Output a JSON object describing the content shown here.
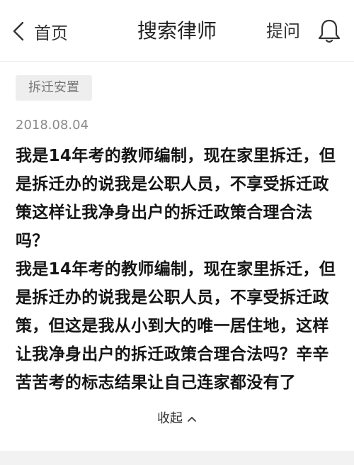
{
  "header": {
    "back_label": "首页",
    "title": "搜索律师",
    "ask_label": "提问"
  },
  "icons": {
    "back": "chevron-left-icon",
    "notifications": "bell-icon",
    "collapse": "chevron-up-icon"
  },
  "question": {
    "tag": "拆迁安置",
    "date": "2018.08.04",
    "title": "我是14年考的教师编制，现在家里拆迁，但是拆迁办的说我是公职人员，不享受拆迁政策这样让我净身出户的拆迁政策合理合法吗？",
    "body": "我是14年考的教师编制，现在家里拆迁，但是拆迁办的说我是公职人员，不享受拆迁政策，但这是我从小到大的唯一居住地，这样让我净身出户的拆迁政策合理合法吗？辛辛苦苦考的标志结果让自己连家都没有了",
    "collapse_label": "收起"
  }
}
